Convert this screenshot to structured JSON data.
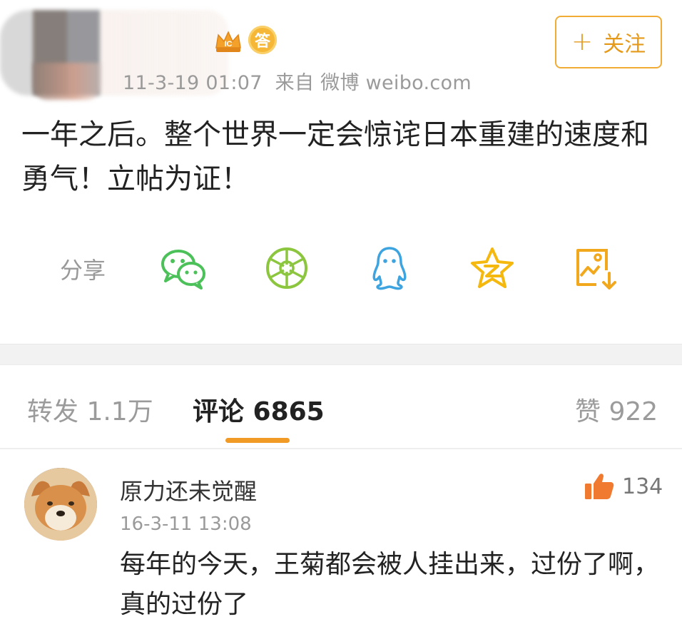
{
  "header": {
    "badge_answer": "答",
    "timestamp": "11-3-19 01:07",
    "source": "来自 微博 weibo.com",
    "follow_label": "关注",
    "follow_plus": "+"
  },
  "post": {
    "text": "一年之后。整个世界一定会惊诧日本重建的速度和勇气！立帖为证！"
  },
  "share": {
    "label": "分享",
    "targets": [
      "wechat-icon",
      "moments-icon",
      "qq-icon",
      "qzone-icon",
      "save-image-icon"
    ]
  },
  "tabs": {
    "repost": "转发 1.1万",
    "comments": "评论 6865",
    "likes": "赞 922"
  },
  "comment": {
    "author": "原力还未觉醒",
    "time": "16-3-11 13:08",
    "like_count": "134",
    "text": "每年的今天，王菊都会被人挂出来，过份了啊，真的过份了"
  },
  "colors": {
    "accent": "#f0ac35",
    "wechat": "#4cc15a",
    "moments": "#8cc63f",
    "qq": "#3ea4e0",
    "qzone": "#f5b80f",
    "save": "#f2a81d",
    "like": "#f07a2f"
  }
}
